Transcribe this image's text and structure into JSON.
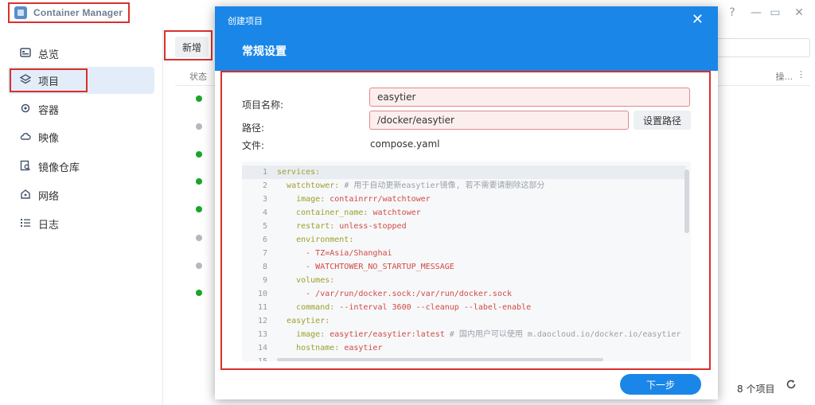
{
  "app": {
    "title": "Container Manager",
    "window_controls": [
      "?",
      "—",
      "▭",
      "✕"
    ]
  },
  "sidebar": {
    "items": [
      {
        "label": "总览",
        "icon": "dashboard-icon",
        "active": false
      },
      {
        "label": "项目",
        "icon": "layers-icon",
        "active": true
      },
      {
        "label": "容器",
        "icon": "gear-icon",
        "active": false
      },
      {
        "label": "映像",
        "icon": "cloud-icon",
        "active": false
      },
      {
        "label": "镜像仓库",
        "icon": "registry-icon",
        "active": false
      },
      {
        "label": "网络",
        "icon": "network-icon",
        "active": false
      },
      {
        "label": "日志",
        "icon": "list-icon",
        "active": false
      }
    ]
  },
  "main": {
    "new_button": "新增",
    "col_status": "状态",
    "col_ops": "操...",
    "col_more": "⋮",
    "rows_status": [
      "running",
      "stopped",
      "running",
      "running",
      "running",
      "stopped",
      "stopped",
      "running"
    ],
    "footer_count": "8 个项目"
  },
  "colors": {
    "accent": "#1a87e8",
    "highlight": "#d9302c",
    "running": "#19a52a",
    "stopped": "#b3b8bf"
  },
  "modal": {
    "caption": "创建项目",
    "close": "✕",
    "heading": "常规设置",
    "name_label": "项目名称:",
    "name_value": "easytier",
    "path_label": "路径:",
    "path_value": "/docker/easytier",
    "set_path_button": "设置路径",
    "file_label": "文件:",
    "file_value": "compose.yaml",
    "next_button": "下一步",
    "code_lines": [
      {
        "n": "1",
        "key": "services:",
        "val": "",
        "comment": "",
        "indent": 0
      },
      {
        "n": "2",
        "key": "watchtower:",
        "val": "",
        "comment": "# 用于自动更新easytier镜像, 若不需要请删除这部分",
        "indent": 2
      },
      {
        "n": "3",
        "key": "image:",
        "val": "containrrr/watchtower",
        "comment": "",
        "indent": 4
      },
      {
        "n": "4",
        "key": "container_name:",
        "val": "watchtower",
        "comment": "",
        "indent": 4
      },
      {
        "n": "5",
        "key": "restart:",
        "val": "unless-stopped",
        "comment": "",
        "indent": 4
      },
      {
        "n": "6",
        "key": "environment:",
        "val": "",
        "comment": "",
        "indent": 4
      },
      {
        "n": "7",
        "key": "- ",
        "val": "TZ=Asia/Shanghai",
        "comment": "",
        "indent": 6
      },
      {
        "n": "8",
        "key": "- ",
        "val": "WATCHTOWER_NO_STARTUP_MESSAGE",
        "comment": "",
        "indent": 6
      },
      {
        "n": "9",
        "key": "volumes:",
        "val": "",
        "comment": "",
        "indent": 4
      },
      {
        "n": "10",
        "key": "- ",
        "val": "/var/run/docker.sock:/var/run/docker.sock",
        "comment": "",
        "indent": 6
      },
      {
        "n": "11",
        "key": "command:",
        "val": "--interval 3600 --cleanup --label-enable",
        "comment": "",
        "indent": 4
      },
      {
        "n": "12",
        "key": "easytier:",
        "val": "",
        "comment": "",
        "indent": 2
      },
      {
        "n": "13",
        "key": "image:",
        "val": "easytier/easytier:latest",
        "comment": "# 国内用户可以使用 m.daocloud.io/docker.io/easytier",
        "indent": 4
      },
      {
        "n": "14",
        "key": "hostname:",
        "val": "easytier",
        "comment": "",
        "indent": 4
      },
      {
        "n": "15",
        "key": "",
        "val": "",
        "comment": "",
        "indent": 4
      }
    ]
  }
}
